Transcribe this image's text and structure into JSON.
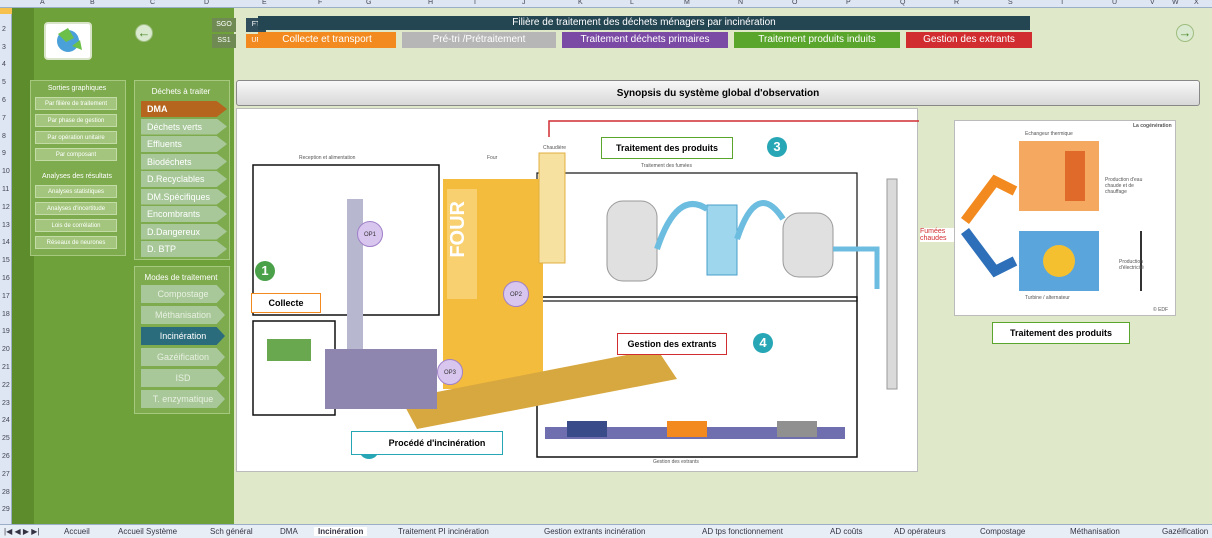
{
  "columns": [
    "A",
    "B",
    "C",
    "D",
    "E",
    "F",
    "G",
    "H",
    "I",
    "J",
    "K",
    "L",
    "M",
    "N",
    "O",
    "P",
    "Q",
    "R",
    "S",
    "T",
    "U",
    "V",
    "W",
    "X"
  ],
  "rows": [
    "1",
    "2",
    "3",
    "4",
    "5",
    "6",
    "7",
    "8",
    "9",
    "10",
    "11",
    "12",
    "13",
    "14",
    "15",
    "16",
    "17",
    "18",
    "19",
    "20",
    "21",
    "22",
    "23",
    "24",
    "25",
    "26",
    "27",
    "28",
    "29"
  ],
  "header": {
    "code_top": "SGO",
    "code_bottom": "SS1",
    "ft": "FT",
    "uf": "UF",
    "title": "Filière de traitement des déchets ménagers par incinération",
    "tabs": [
      {
        "label": "Collecte et transport",
        "color": "#f28a1f"
      },
      {
        "label": "Pré-tri /Prétraitement",
        "color": "#b6b6b6"
      },
      {
        "label": "Traitement déchets primaires",
        "color": "#7b4aa5"
      },
      {
        "label": "Traitement produits induits",
        "color": "#5aa62d"
      },
      {
        "label": "Gestion des extrants",
        "color": "#d12d31"
      }
    ]
  },
  "left_panel": {
    "graph_title": "Sorties graphiques",
    "graph_items": [
      "Par filière de traitement",
      "Par phase de gestion",
      "Par opération unitaire",
      "Par composant"
    ],
    "analysis_title": "Analyses des résultats",
    "analysis_items": [
      "Analyses statistiques",
      "Analyses d'incertitude",
      "Lois de corrélation",
      "Réseaux de neurones"
    ]
  },
  "waste_panel": {
    "title": "Déchets à traiter",
    "items": [
      "DMA",
      "Déchets verts",
      "Effluents",
      "Biodéchets",
      "D.Recyclables",
      "DM.Spécifiques",
      "Encombrants",
      "D.Dangereux",
      "D. BTP"
    ],
    "selected": "DMA"
  },
  "mode_panel": {
    "title": "Modes de traitement",
    "items": [
      "Compostage",
      "Méthanisation",
      "Incinération",
      "Gazéification",
      "ISD",
      "T. enzymatique"
    ],
    "selected": "Incinération"
  },
  "synopsis": {
    "title": "Synopsis du système global d'observation",
    "labels": {
      "collecte": "Collecte",
      "procede": "Procédé d'incinération",
      "traitement_produits": "Traitement des produits",
      "gestion_extrants": "Gestion des extrants",
      "traitement_produits_right": "Traitement des produits"
    },
    "numbers": [
      "1",
      "2",
      "3",
      "4"
    ],
    "ops": [
      "OP1",
      "OP2",
      "OP3"
    ],
    "small": {
      "reception": "Reception et alimentation",
      "four": "Four",
      "chaudiere": "Chaudière",
      "fumees_title": "Traitement des fumées",
      "gestion_small": "Gestion des extrants",
      "fumees": "Fumées chaudes",
      "cogeneration": "La cogénération",
      "four_big": "FOUR",
      "echangeur": "Echangeur thermique",
      "eau_chaude": "Production d'eau chaude et de chauffage",
      "turbine": "Turbine / alternateur",
      "electricite": "Production d'électricité",
      "edf": "© EDF"
    }
  },
  "sheet_tabs": [
    "Accueil",
    "Accueil Système",
    "Sch général",
    "DMA",
    "Incinération",
    "Traitement PI incinération",
    "Gestion extrants incinération",
    "AD tps fonctionnement",
    "AD coûts",
    "AD opérateurs",
    "Compostage",
    "Méthanisation",
    "Gazéification"
  ],
  "active_sheet": "Incinération"
}
